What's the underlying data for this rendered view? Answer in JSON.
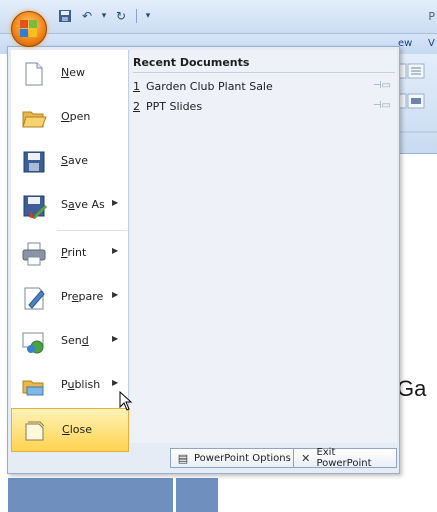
{
  "titlebar": {
    "qat_items": [
      {
        "name": "save",
        "glyph": "💾"
      },
      {
        "name": "undo",
        "glyph": "↶"
      },
      {
        "name": "undo-dropdown",
        "glyph": "▾"
      },
      {
        "name": "repeat",
        "glyph": "↻"
      },
      {
        "name": "customize",
        "glyph": "▾"
      }
    ],
    "title_fragment": "P"
  },
  "ribbon": {
    "tabs": [
      "ew",
      "V"
    ]
  },
  "slide": {
    "text": "Ga"
  },
  "office_menu": {
    "items": [
      {
        "key": "new",
        "label": "New",
        "mnemonic": "N",
        "has_submenu": false
      },
      {
        "key": "open",
        "label": "Open",
        "mnemonic": "O",
        "has_submenu": false
      },
      {
        "key": "save",
        "label": "Save",
        "mnemonic": "S",
        "has_submenu": false
      },
      {
        "key": "save-as",
        "label": "Save As",
        "mnemonic": "A",
        "has_submenu": true
      },
      {
        "key": "print",
        "label": "Print",
        "mnemonic": "P",
        "has_submenu": true
      },
      {
        "key": "prepare",
        "label": "Prepare",
        "mnemonic": "E",
        "has_submenu": true
      },
      {
        "key": "send",
        "label": "Send",
        "mnemonic": "D",
        "has_submenu": true
      },
      {
        "key": "publish",
        "label": "Publish",
        "mnemonic": "U",
        "has_submenu": true
      },
      {
        "key": "close",
        "label": "Close",
        "mnemonic": "C",
        "has_submenu": false
      }
    ],
    "recent": {
      "title": "Recent Documents",
      "documents": [
        {
          "num": "1",
          "name": "Garden Club Plant Sale"
        },
        {
          "num": "2",
          "name": "PPT Slides"
        }
      ]
    },
    "footer": {
      "options_label": "PowerPoint Options",
      "exit_label": "Exit PowerPoint"
    }
  },
  "colors": {
    "hover_highlight": "#ffd34f",
    "menu_background": "#e6ecf5",
    "office_button": "#f07f13"
  }
}
